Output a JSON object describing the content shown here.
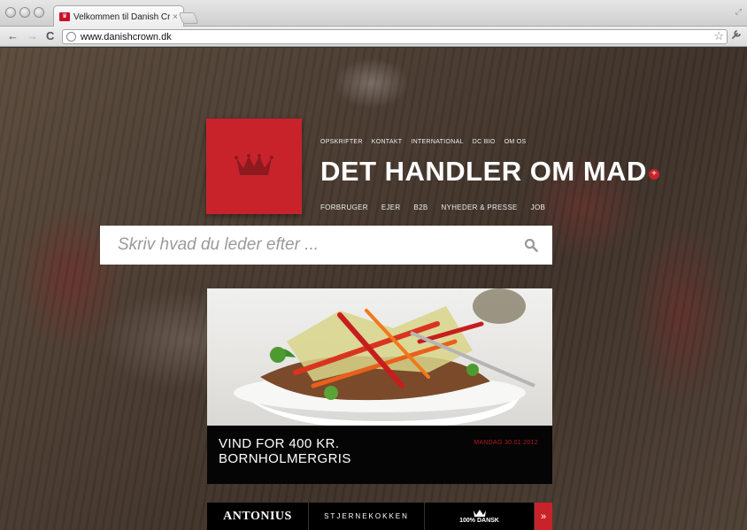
{
  "browser": {
    "tab_title": "Velkommen til Danish Crown",
    "tab_close": "×",
    "url": "www.danishcrown.dk",
    "back": "←",
    "forward": "→",
    "reload": "C",
    "bookmark": "☆"
  },
  "site": {
    "top_nav": [
      "OPSKRIFTER",
      "KONTAKT",
      "INTERNATIONAL",
      "DC BIO",
      "OM OS"
    ],
    "headline": "DET HANDLER OM MAD",
    "main_nav": [
      "FORBRUGER",
      "EJER",
      "B2B",
      "NYHEDER & PRESSE",
      "JOB"
    ],
    "plus": "+",
    "search_placeholder": "Skriv hvad du leder efter ...",
    "feature": {
      "title": "VIND FOR 400 KR. BORNHOLMERGRIS",
      "date": "MANDAG 30.01.2012"
    },
    "brands": [
      "ANTONIUS",
      "STJERNEKOKKEN",
      "100% DANSK"
    ],
    "brands_arrow": "»",
    "accent": "#c8232b"
  }
}
